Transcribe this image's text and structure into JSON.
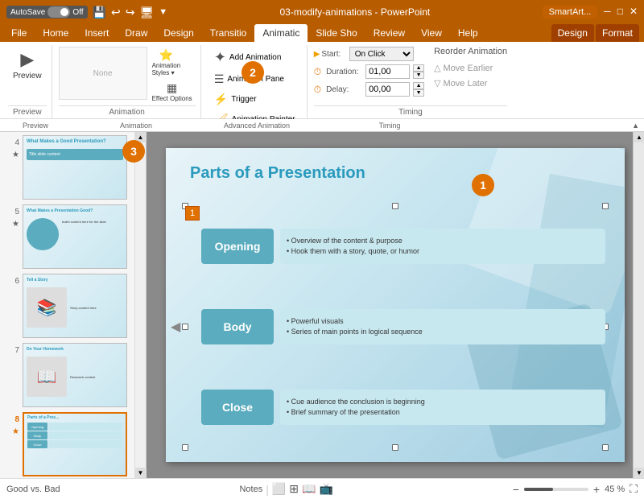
{
  "titlebar": {
    "autosave": "AutoSave",
    "off": "Off",
    "filename": "03-modify-animations - PowerPoint",
    "smartart_label": "SmartArt...",
    "minimize": "─",
    "restore": "□",
    "close": "✕"
  },
  "tabs": {
    "items": [
      "File",
      "Home",
      "Insert",
      "Draw",
      "Design",
      "Transitio",
      "Animatic",
      "Slide Sho",
      "Review",
      "View",
      "Help"
    ],
    "active": "Animatic",
    "contextual": [
      "Design",
      "Format"
    ]
  },
  "ribbon": {
    "preview_label": "Preview",
    "animation_styles_label": "Animation Styles",
    "effect_options_label": "Effect Options",
    "add_animation_label": "Add Animation",
    "animation_painter_label": "Animation Painter",
    "trigger_label": "Trigger",
    "animation_pane_label": "Animation Pane",
    "preview_group": "Preview",
    "animation_group": "Animation",
    "advanced_group": "Advanced Animation",
    "timing_group": "Timing",
    "start_label": "Start:",
    "start_value": "On Click",
    "duration_label": "Duration:",
    "duration_value": "01,00",
    "delay_label": "Delay:",
    "delay_value": "00,00",
    "reorder_title": "Reorder Animation",
    "move_earlier": "Move Earlier",
    "move_later": "Move Later"
  },
  "slides": [
    {
      "num": "4",
      "star": true,
      "selected": false
    },
    {
      "num": "5",
      "star": true,
      "selected": false
    },
    {
      "num": "6",
      "star": false,
      "selected": false
    },
    {
      "num": "7",
      "star": false,
      "selected": false
    },
    {
      "num": "8",
      "star": true,
      "selected": true
    }
  ],
  "slide": {
    "title": "Parts of a Presentation",
    "smartart_rows": [
      {
        "label": "Opening",
        "bullets": [
          "Overview of the content & purpose",
          "Hook them with a story, quote, or humor"
        ]
      },
      {
        "label": "Body",
        "bullets": [
          "Powerful visuals",
          "Series of main points in logical sequence"
        ]
      },
      {
        "label": "Close",
        "bullets": [
          "Cue audience the conclusion is beginning",
          "Brief summary of the presentation"
        ]
      }
    ],
    "animation_number": "1"
  },
  "callouts": {
    "badge1": "1",
    "badge2": "2",
    "badge3": "3"
  },
  "statusbar": {
    "notes_label": "Notes",
    "zoom_pct": "45 %"
  }
}
